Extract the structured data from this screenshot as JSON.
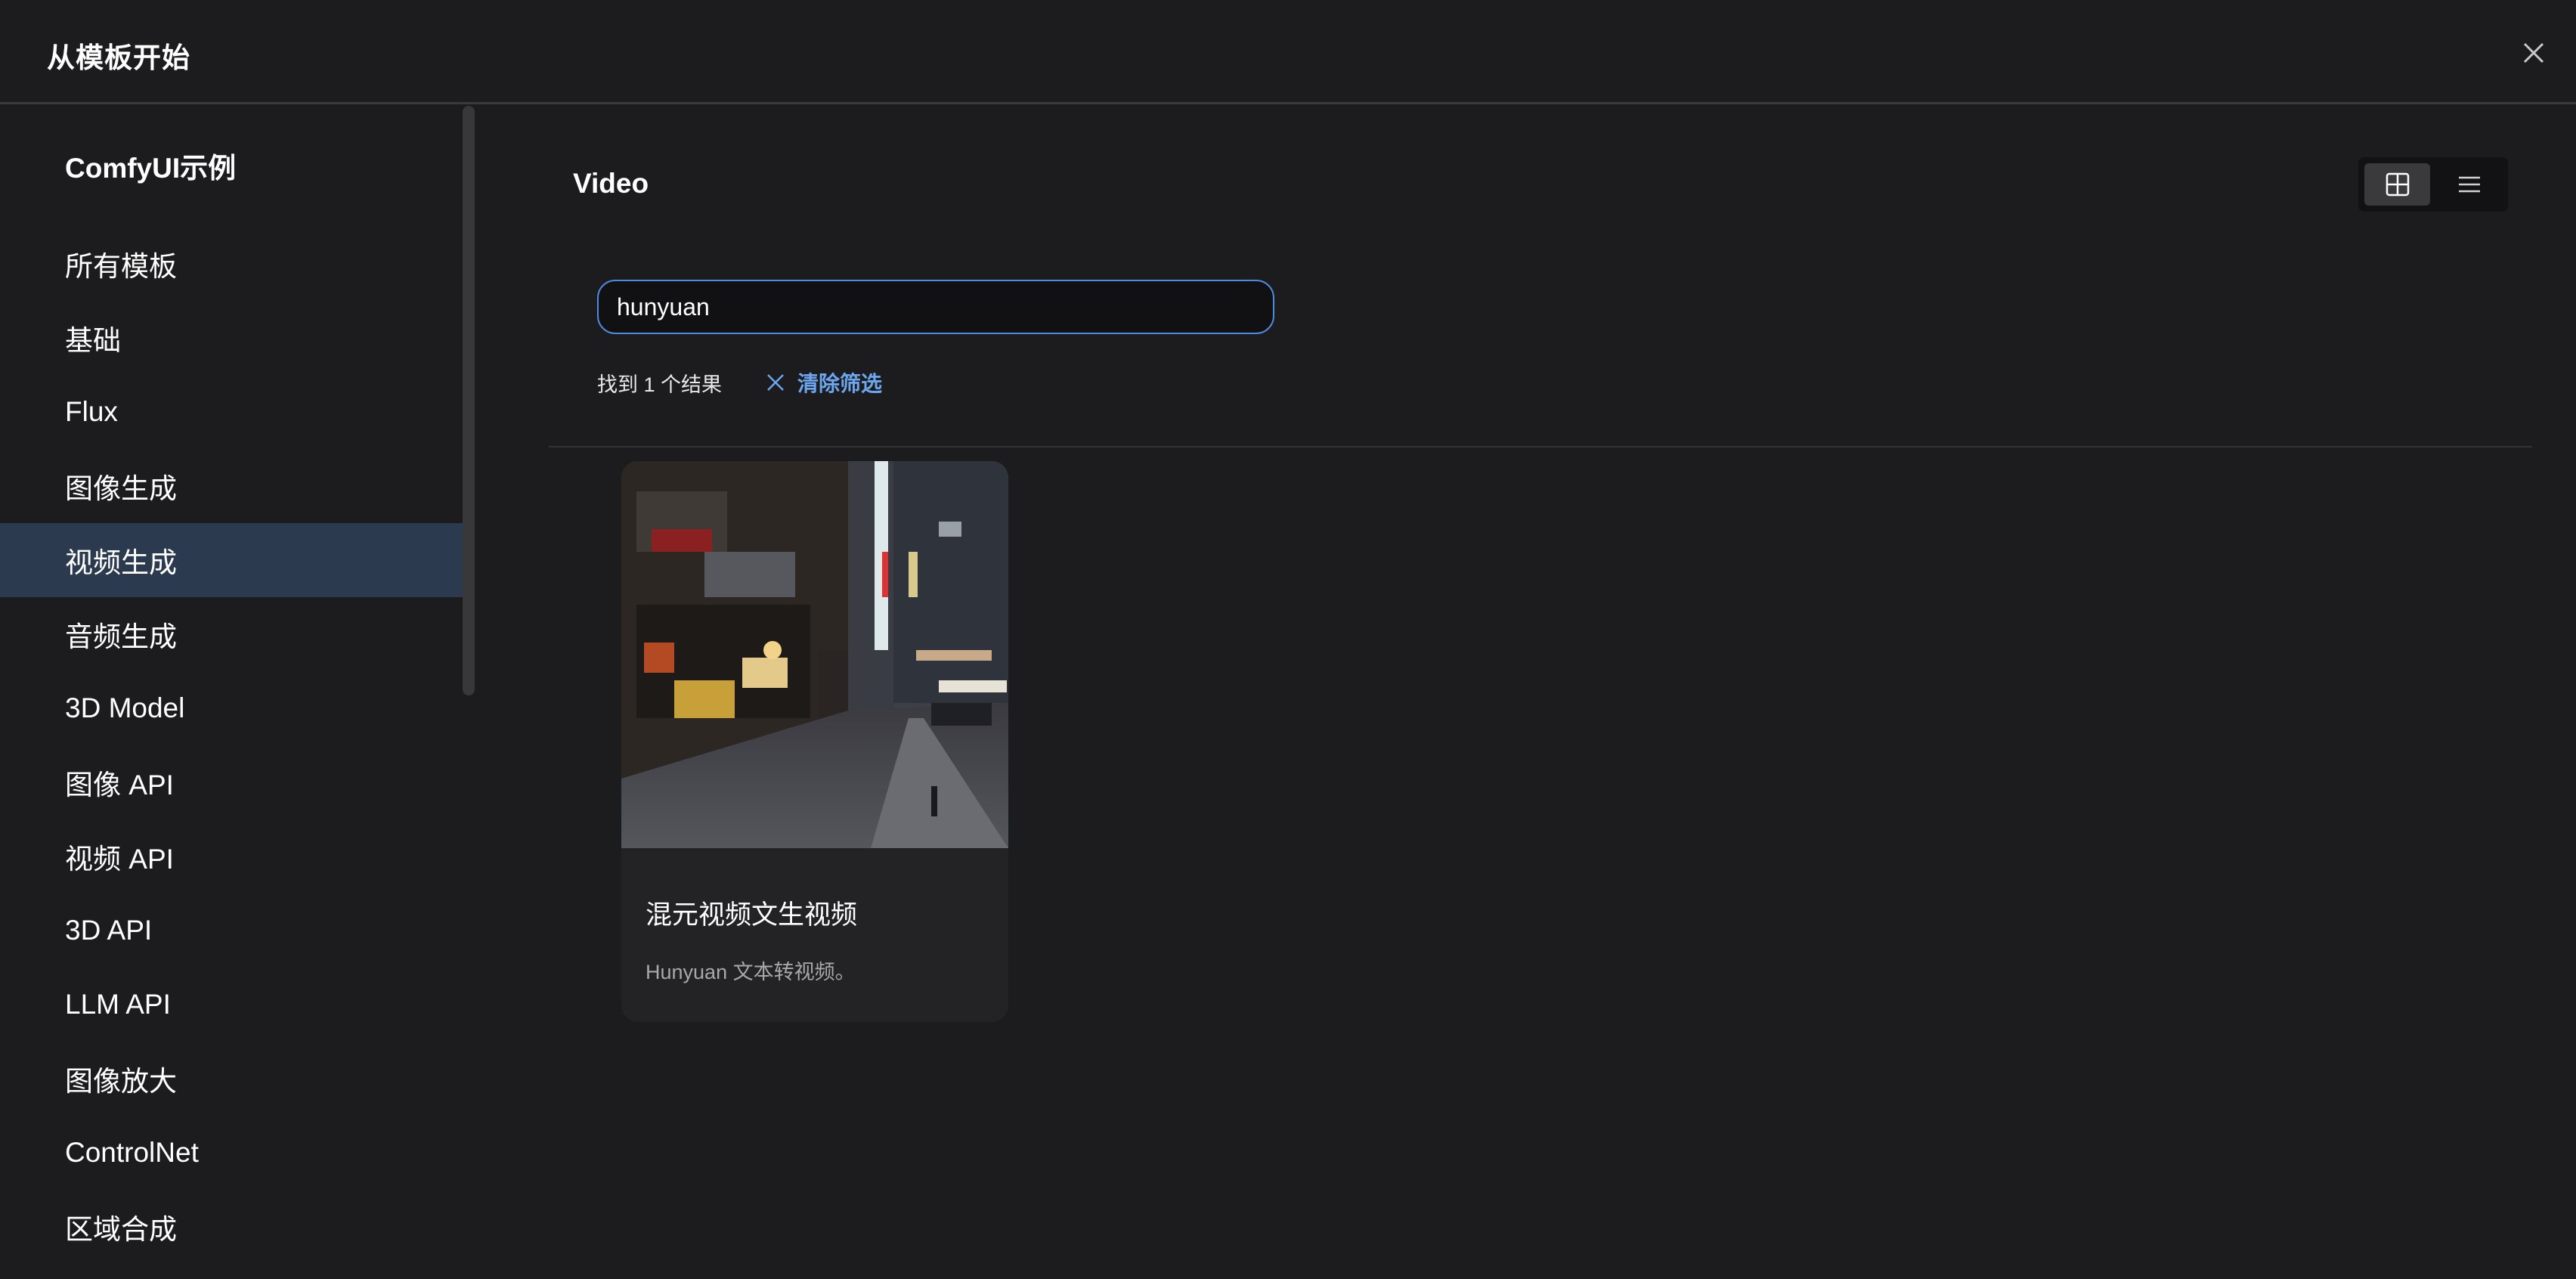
{
  "dialog": {
    "title": "从模板开始"
  },
  "sidebar": {
    "heading": "ComfyUI示例",
    "items": [
      {
        "label": "所有模板",
        "active": false
      },
      {
        "label": "基础",
        "active": false
      },
      {
        "label": "Flux",
        "active": false
      },
      {
        "label": "图像生成",
        "active": false
      },
      {
        "label": "视频生成",
        "active": true
      },
      {
        "label": "音频生成",
        "active": false
      },
      {
        "label": "3D Model",
        "active": false
      },
      {
        "label": "图像 API",
        "active": false
      },
      {
        "label": "视频 API",
        "active": false
      },
      {
        "label": "3D API",
        "active": false
      },
      {
        "label": "LLM API",
        "active": false
      },
      {
        "label": "图像放大",
        "active": false
      },
      {
        "label": "ControlNet",
        "active": false
      },
      {
        "label": "区域合成",
        "active": false
      }
    ]
  },
  "main": {
    "section_title": "Video",
    "view_toggle": {
      "grid_icon": "grid-icon",
      "list_icon": "list-icon",
      "active": "grid"
    },
    "search": {
      "value": "hunyuan"
    },
    "results": {
      "count_text": "找到 1 个结果",
      "clear_label": "清除筛选"
    },
    "cards": [
      {
        "title": "混元视频文生视频",
        "description": "Hunyuan 文本转视频。",
        "thumbnail": "night-city-street-thumbnail"
      }
    ]
  },
  "colors": {
    "background": "#1c1c1e",
    "active_sidebar": "#2b3a4e",
    "accent": "#6ba6ef",
    "search_border": "#4c8be0"
  }
}
